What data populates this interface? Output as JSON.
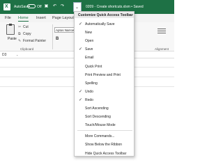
{
  "titlebar": {
    "autosave_label": "AutoSave",
    "toggle_label": "Off",
    "doc_title": "0209 - Create shortcuts.xlsm • Saved"
  },
  "tabs": [
    "File",
    "Home",
    "Insert",
    "Page Layout"
  ],
  "ribbon": {
    "paste": "Paste",
    "cut": "Cut",
    "copy": "Copy",
    "format_painter": "Format Painter",
    "clipboard": "Clipboard",
    "font": "Aptos Narrow",
    "bold": "B",
    "alignment": "Alignment"
  },
  "formula_bar": {
    "name_box": "D3"
  },
  "menu": {
    "header": "Customize Quick Access Toolbar",
    "items": [
      {
        "label": "Automatically Save",
        "checked": true
      },
      {
        "label": "New",
        "checked": false
      },
      {
        "label": "Open",
        "checked": false
      },
      {
        "label": "Save",
        "checked": true
      },
      {
        "label": "Email",
        "checked": false
      },
      {
        "label": "Quick Print",
        "checked": false
      },
      {
        "label": "Print Preview and Print",
        "checked": false
      },
      {
        "label": "Spelling",
        "checked": false
      },
      {
        "label": "Undo",
        "checked": true
      },
      {
        "label": "Redo",
        "checked": true
      },
      {
        "label": "Sort Ascending",
        "checked": false
      },
      {
        "label": "Sort Descending",
        "checked": false
      },
      {
        "label": "Touch/Mouse Mode",
        "checked": false
      }
    ],
    "footer_items": [
      "More Commands...",
      "Show Below the Ribbon",
      "Hide Quick Access Toolbar"
    ],
    "check_glyph": "✓"
  },
  "colors": {
    "excel_green": "#1e7145"
  }
}
